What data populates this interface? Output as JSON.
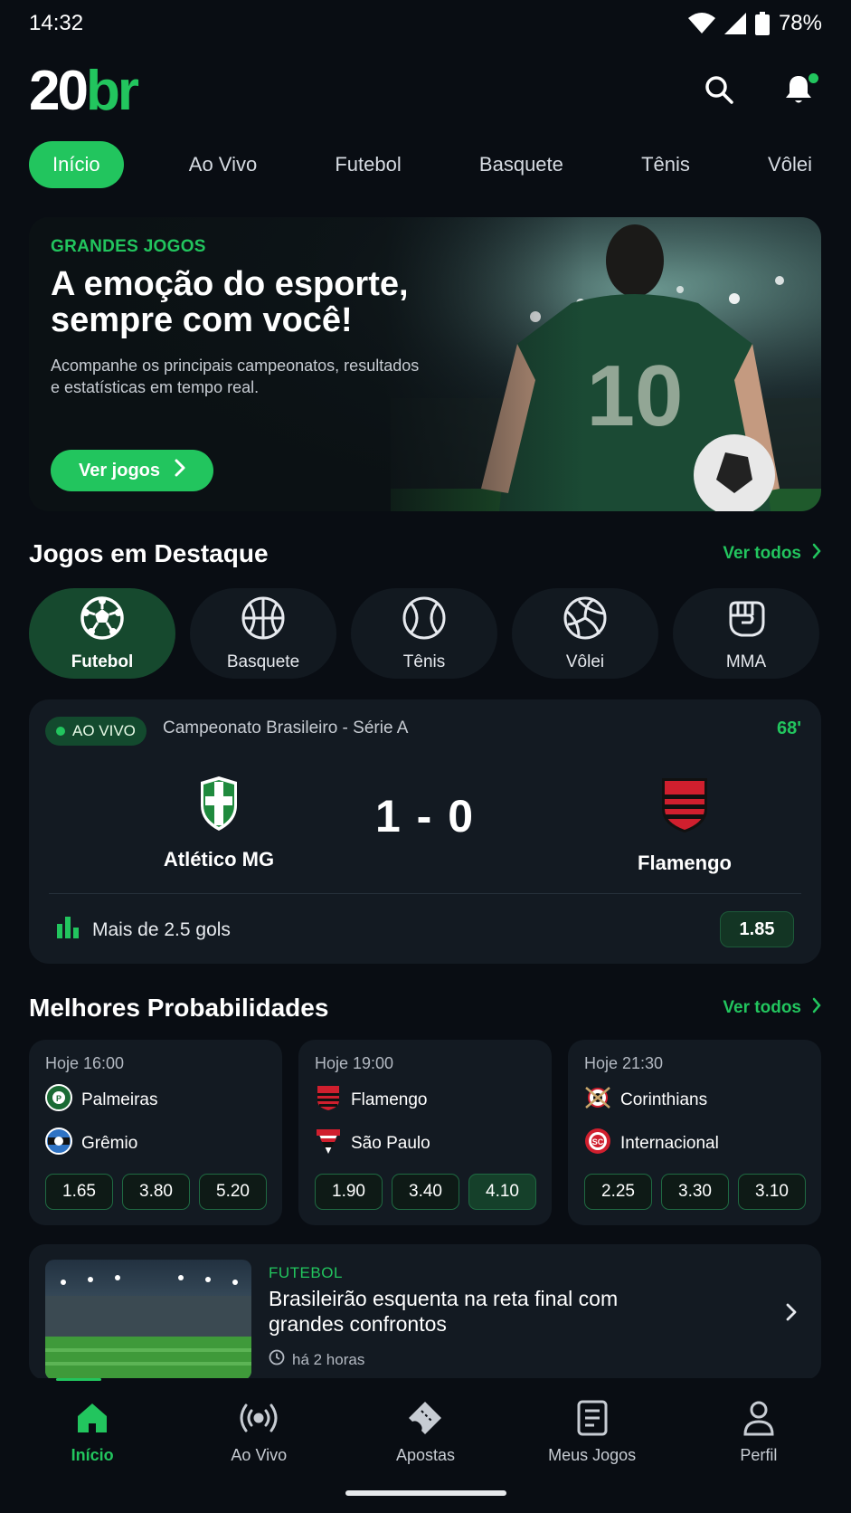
{
  "status_bar": {
    "time": "14:32",
    "battery": "78%"
  },
  "header": {
    "logo_main": "20",
    "logo_accent": "br"
  },
  "category_tabs": [
    "Início",
    "Ao Vivo",
    "Futebol",
    "Basquete",
    "Tênis",
    "Vôlei"
  ],
  "hero": {
    "eyebrow": "GRANDES JOGOS",
    "title": "A emoção do esporte, sempre com você!",
    "subtitle": "Acompanhe os principais campeonatos, resultados e estatísticas em tempo real.",
    "button": "Ver jogos",
    "jersey_number": "10"
  },
  "featured": {
    "title": "Jogos em Destaque",
    "see_all": "Ver todos",
    "sports": [
      {
        "label": "Futebol",
        "icon": "soccer-ball-icon",
        "active": true
      },
      {
        "label": "Basquete",
        "icon": "basketball-icon",
        "active": false
      },
      {
        "label": "Tênis",
        "icon": "tennis-ball-icon",
        "active": false
      },
      {
        "label": "Vôlei",
        "icon": "volleyball-icon",
        "active": false
      },
      {
        "label": "MMA",
        "icon": "fist-icon",
        "active": false
      }
    ]
  },
  "live_match": {
    "badge": "AO VIVO",
    "league": "Campeonato Brasileiro - Série A",
    "minute": "68'",
    "home": "Atlético MG",
    "away": "Flamengo",
    "score": "1 - 0",
    "market": "Mais de 2.5 gols",
    "odd": "1.85"
  },
  "best_odds": {
    "title": "Melhores Probabilidades",
    "see_all": "Ver todos",
    "matches": [
      {
        "time": "Hoje 16:00",
        "home": "Palmeiras",
        "away": "Grêmio",
        "odds": [
          "1.65",
          "3.80",
          "5.20"
        ]
      },
      {
        "time": "Hoje 19:00",
        "home": "Flamengo",
        "away": "São Paulo",
        "odds": [
          "1.90",
          "3.40",
          "4.10"
        ]
      },
      {
        "time": "Hoje 21:30",
        "home": "Corinthians",
        "away": "Internacional",
        "odds": [
          "2.25",
          "3.30",
          "3.10"
        ]
      }
    ]
  },
  "news": {
    "tag": "FUTEBOL",
    "title": "Brasileirão esquenta na reta final com grandes confrontos",
    "time": "há 2 horas"
  },
  "bottom_nav": [
    "Início",
    "Ao Vivo",
    "Apostas",
    "Meus Jogos",
    "Perfil"
  ],
  "colors": {
    "accent": "#22c55e",
    "background": "#090d13",
    "card": "#131a22"
  }
}
